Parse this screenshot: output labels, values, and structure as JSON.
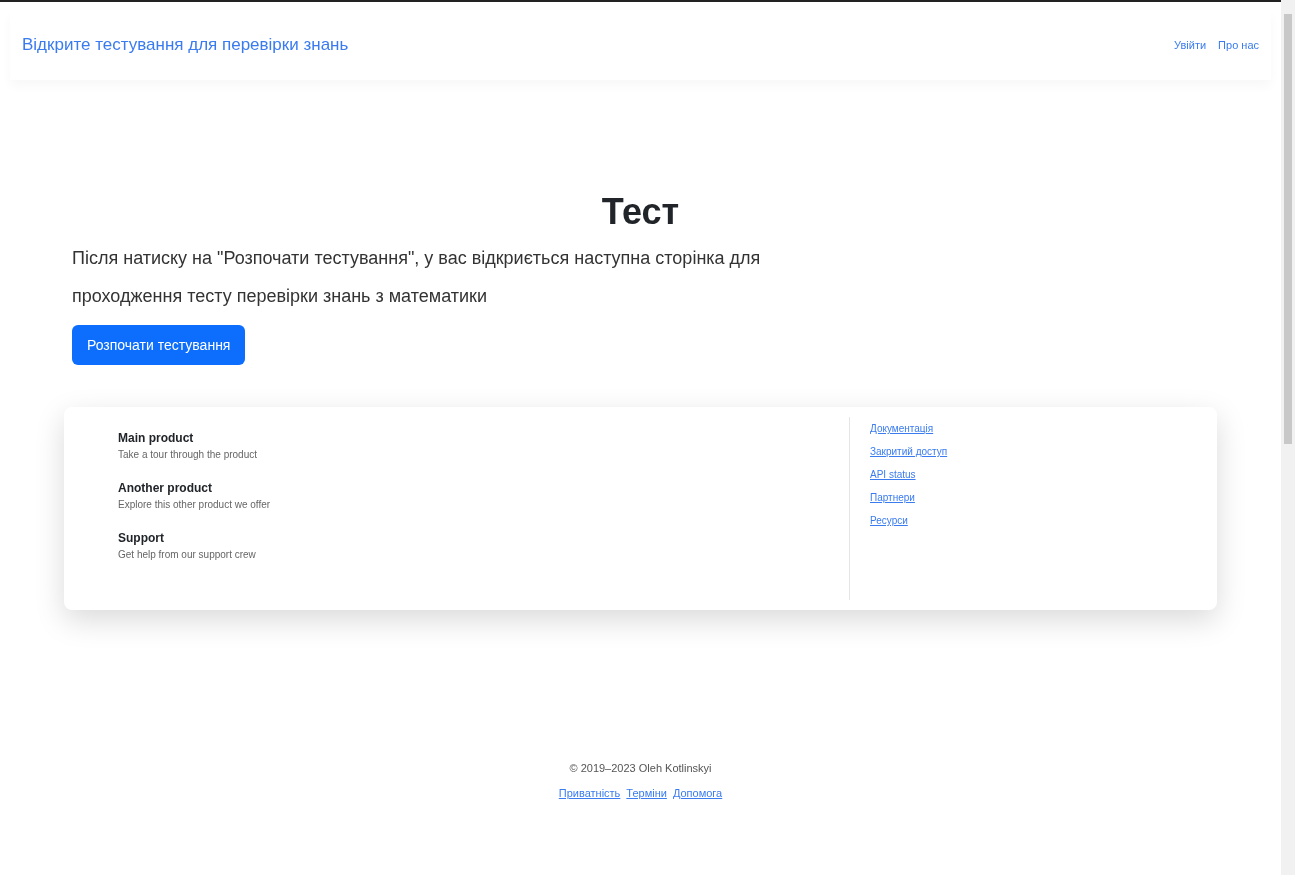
{
  "navbar": {
    "brand": "Відкрите тестування для перевірки знань",
    "links": [
      "Увійти",
      "Про нас"
    ]
  },
  "hero": {
    "title": "Тест",
    "text": "Після натиску на \"Розпочати тестування\", у вас відкриється наступна сторінка для проходження тесту перевірки знань з математики",
    "button": "Розпочати тестування"
  },
  "card": {
    "items": [
      {
        "title": "Main product",
        "description": "Take a tour through the product"
      },
      {
        "title": "Another product",
        "description": "Explore this other product we offer"
      },
      {
        "title": "Support",
        "description": "Get help from our support crew"
      }
    ],
    "links": [
      "Документація",
      "Закритий доступ",
      "API status",
      "Партнери",
      "Ресурси"
    ]
  },
  "footer": {
    "copyright": "© 2019–2023 Oleh Kotlinskyi",
    "links": [
      "Приватність",
      "Терміни",
      "Допомога"
    ]
  }
}
